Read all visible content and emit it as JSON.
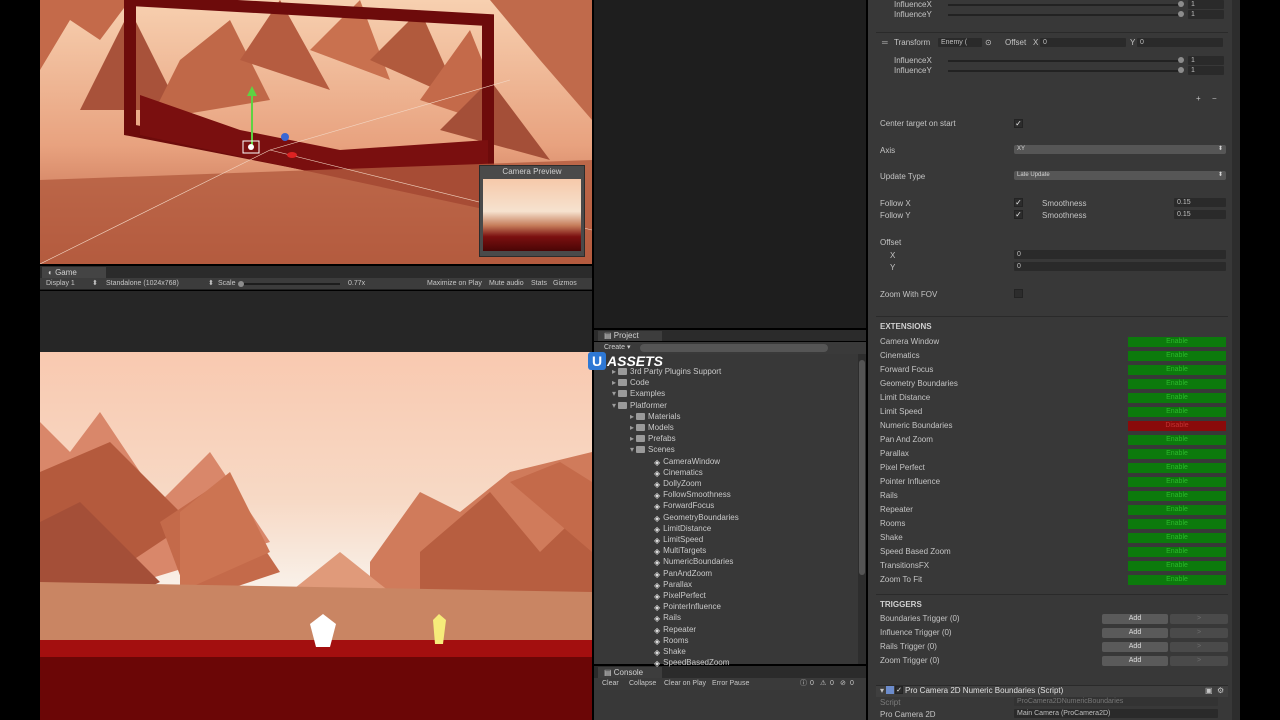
{
  "scene": {
    "camera_preview_title": "Camera Preview"
  },
  "game": {
    "tab_label": "Game",
    "display": "Display 1",
    "resolution": "Standalone (1024x768)",
    "scale_label": "Scale",
    "scale_value": "0.77x",
    "maximize": "Maximize on Play",
    "mute": "Mute audio",
    "stats": "Stats",
    "gizmos": "Gizmos"
  },
  "project": {
    "tab_label": "Project",
    "create_label": "Create",
    "tree": [
      {
        "label": "ASSETS",
        "depth": 0,
        "type": "folder"
      },
      {
        "label": "3rd Party Plugins Support",
        "depth": 1,
        "type": "folder"
      },
      {
        "label": "Code",
        "depth": 1,
        "type": "folder"
      },
      {
        "label": "Examples",
        "depth": 1,
        "type": "folder"
      },
      {
        "label": "Platformer",
        "depth": 2,
        "type": "folder"
      },
      {
        "label": "Materials",
        "depth": 3,
        "type": "folder"
      },
      {
        "label": "Models",
        "depth": 3,
        "type": "folder"
      },
      {
        "label": "Prefabs",
        "depth": 3,
        "type": "folder"
      },
      {
        "label": "Scenes",
        "depth": 3,
        "type": "folder"
      },
      {
        "label": "CameraWindow",
        "depth": 4,
        "type": "scene"
      },
      {
        "label": "Cinematics",
        "depth": 4,
        "type": "scene"
      },
      {
        "label": "DollyZoom",
        "depth": 4,
        "type": "scene"
      },
      {
        "label": "FollowSmoothness",
        "depth": 4,
        "type": "scene"
      },
      {
        "label": "ForwardFocus",
        "depth": 4,
        "type": "scene"
      },
      {
        "label": "GeometryBoundaries",
        "depth": 4,
        "type": "scene"
      },
      {
        "label": "LimitDistance",
        "depth": 4,
        "type": "scene"
      },
      {
        "label": "LimitSpeed",
        "depth": 4,
        "type": "scene"
      },
      {
        "label": "MultiTargets",
        "depth": 4,
        "type": "scene"
      },
      {
        "label": "NumericBoundaries",
        "depth": 4,
        "type": "scene"
      },
      {
        "label": "PanAndZoom",
        "depth": 4,
        "type": "scene"
      },
      {
        "label": "Parallax",
        "depth": 4,
        "type": "scene"
      },
      {
        "label": "PixelPerfect",
        "depth": 4,
        "type": "scene"
      },
      {
        "label": "PointerInfluence",
        "depth": 4,
        "type": "scene"
      },
      {
        "label": "Rails",
        "depth": 4,
        "type": "scene"
      },
      {
        "label": "Repeater",
        "depth": 4,
        "type": "scene"
      },
      {
        "label": "Rooms",
        "depth": 4,
        "type": "scene"
      },
      {
        "label": "Shake",
        "depth": 4,
        "type": "scene"
      },
      {
        "label": "SpeedBasedZoom",
        "depth": 4,
        "type": "scene"
      }
    ]
  },
  "console": {
    "tab_label": "Console",
    "clear": "Clear",
    "collapse": "Collapse",
    "clear_on_play": "Clear on Play",
    "error_pause": "Error Pause",
    "counts": [
      "0",
      "0",
      "0"
    ]
  },
  "inspector": {
    "influence_x": "InfluenceX",
    "influence_y": "InfluenceY",
    "top_influence_x_val": "1",
    "top_influence_y_val": "1",
    "transform_label": "Transform",
    "transform_value": "Enemy (",
    "offset_label": "Offset",
    "offset_x_label": "X",
    "offset_x_val": "0",
    "offset_y_label": "Y",
    "offset_y_val": "0",
    "inf2_x_val": "1",
    "inf2_y_val": "1",
    "plus": "+",
    "minus": "−",
    "center_target": "Center target on start",
    "axis_label": "Axis",
    "axis_value": "XY",
    "update_label": "Update Type",
    "update_value": "Late Update",
    "follow_x": "Follow X",
    "follow_y": "Follow Y",
    "smoothness": "Smoothness",
    "smooth_x_val": "0.15",
    "smooth_y_val": "0.15",
    "offset_section": "Offset",
    "off_x": "X",
    "off_y": "Y",
    "off_x_val": "0",
    "off_y_val": "0",
    "zoom_fov": "Zoom With FOV",
    "extensions_title": "EXTENSIONS",
    "extensions": [
      {
        "name": "Camera Window",
        "button": "Enable",
        "state": "enable"
      },
      {
        "name": "Cinematics",
        "button": "Enable",
        "state": "enable"
      },
      {
        "name": "Forward Focus",
        "button": "Enable",
        "state": "enable"
      },
      {
        "name": "Geometry Boundaries",
        "button": "Enable",
        "state": "enable"
      },
      {
        "name": "Limit Distance",
        "button": "Enable",
        "state": "enable"
      },
      {
        "name": "Limit Speed",
        "button": "Enable",
        "state": "enable"
      },
      {
        "name": "Numeric Boundaries",
        "button": "Disable",
        "state": "disable"
      },
      {
        "name": "Pan And Zoom",
        "button": "Enable",
        "state": "enable"
      },
      {
        "name": "Parallax",
        "button": "Enable",
        "state": "enable"
      },
      {
        "name": "Pixel Perfect",
        "button": "Enable",
        "state": "enable"
      },
      {
        "name": "Pointer Influence",
        "button": "Enable",
        "state": "enable"
      },
      {
        "name": "Rails",
        "button": "Enable",
        "state": "enable"
      },
      {
        "name": "Repeater",
        "button": "Enable",
        "state": "enable"
      },
      {
        "name": "Rooms",
        "button": "Enable",
        "state": "enable"
      },
      {
        "name": "Shake",
        "button": "Enable",
        "state": "enable"
      },
      {
        "name": "Speed Based Zoom",
        "button": "Enable",
        "state": "enable"
      },
      {
        "name": "TransitionsFX",
        "button": "Enable",
        "state": "enable"
      },
      {
        "name": "Zoom To Fit",
        "button": "Enable",
        "state": "enable"
      }
    ],
    "triggers_title": "TRIGGERS",
    "triggers": [
      {
        "name": "Boundaries Trigger (0)",
        "add": "Add",
        "go": ">"
      },
      {
        "name": "Influence Trigger (0)",
        "add": "Add",
        "go": ">"
      },
      {
        "name": "Rails Trigger (0)",
        "add": "Add",
        "go": ">"
      },
      {
        "name": "Zoom Trigger (0)",
        "add": "Add",
        "go": ">"
      }
    ],
    "component_title": "Pro Camera 2D Numeric Boundaries (Script)",
    "script_label": "Script",
    "script_value": "ProCamera2DNumericBoundaries",
    "procam_label": "Pro Camera 2D",
    "procam_value": "Main Camera (ProCamera2D)"
  },
  "colors": {
    "enable_green": "#0c7a0c",
    "disable_red": "#8a0a0a",
    "panel": "#383838"
  }
}
